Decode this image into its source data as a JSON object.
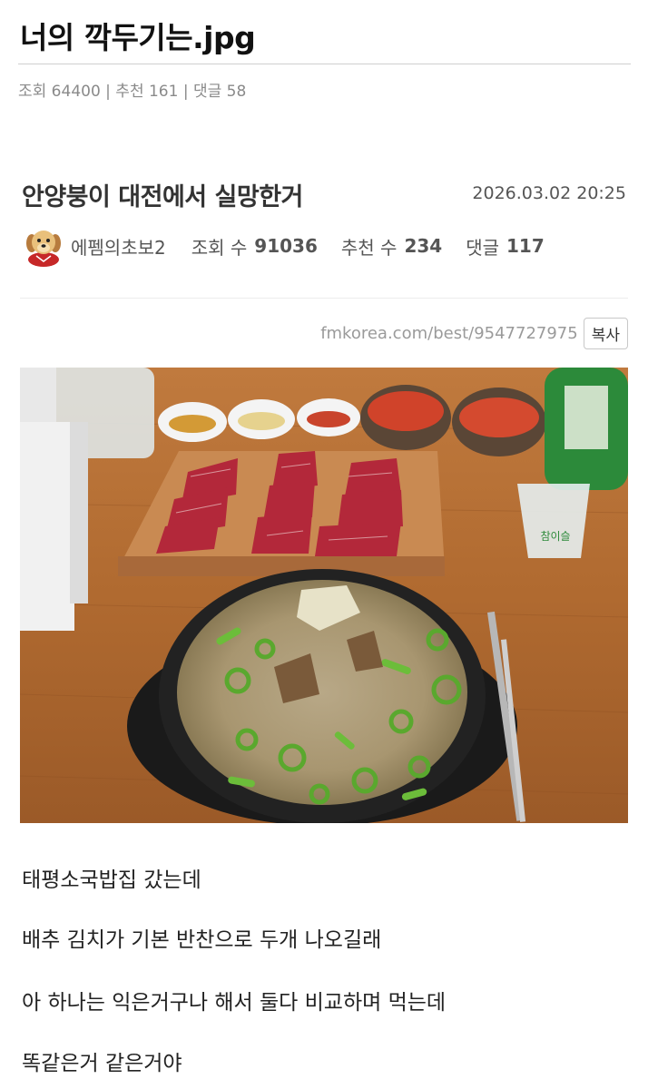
{
  "page": {
    "title": "너의 깍두기는.jpg",
    "stats": "조회 64400 | 추천 161 | 댓글 58"
  },
  "post": {
    "title": "안양붕이 대전에서 실망한거",
    "date": "2026.03.02 20:25",
    "author": "에펨의초보2",
    "views_label": "조회 수",
    "views": "91036",
    "recommend_label": "추천 수",
    "recommend": "234",
    "comments_label": "댓글",
    "comments": "117",
    "url": "fmkorea.com/best/9547727975",
    "copy_label": "복사",
    "photo_bottle_label": "참이슬"
  },
  "body": {
    "lines": [
      "태평소국밥집 갔는데",
      "배추 김치가 기본 반찬으로 두개 나오길래",
      "아 하나는 익은거구나 해서 둘다 비교하며 먹는데",
      "똑같은거 같은거야"
    ]
  },
  "icons": {
    "avatar": "puppy-avatar-icon"
  }
}
